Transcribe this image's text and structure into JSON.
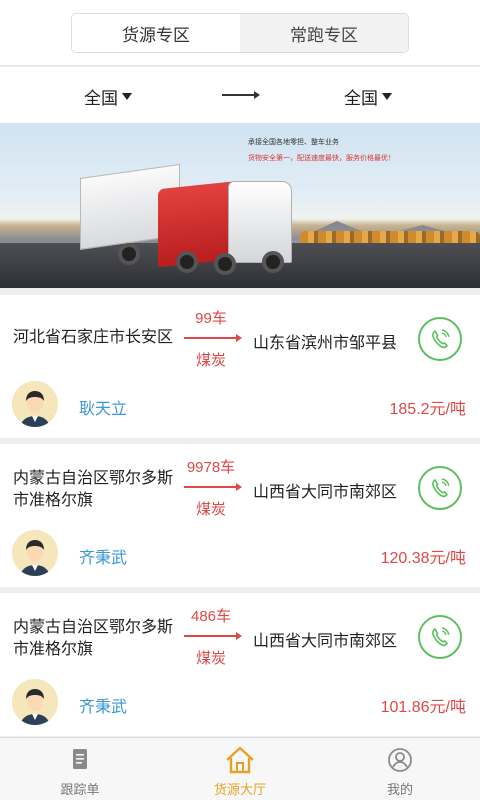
{
  "segment": {
    "tabs": [
      {
        "label": "货源专区",
        "active": true
      },
      {
        "label": "常跑专区",
        "active": false
      }
    ]
  },
  "route_filter": {
    "from": "全国",
    "to": "全国"
  },
  "banner": {
    "line1": "承接全国各地零担、整车业务",
    "line2": "货物安全第一，配送速度最快，服务价格最优！"
  },
  "listings": [
    {
      "origin": "河北省石家庄市长安区",
      "count": "99车",
      "cargo": "煤炭",
      "destination": "山东省滨州市邹平县",
      "name": "耿天立",
      "price": "185.2元/吨"
    },
    {
      "origin": "内蒙古自治区鄂尔多斯市准格尔旗",
      "count": "9978车",
      "cargo": "煤炭",
      "destination": "山西省大同市南郊区",
      "name": "齐秉武",
      "price": "120.38元/吨"
    },
    {
      "origin": "内蒙古自治区鄂尔多斯市准格尔旗",
      "count": "486车",
      "cargo": "煤炭",
      "destination": "山西省大同市南郊区",
      "name": "齐秉武",
      "price": "101.86元/吨"
    }
  ],
  "tabbar": {
    "items": [
      {
        "label": "跟踪单",
        "icon": "document-icon",
        "active": false
      },
      {
        "label": "货源大厅",
        "icon": "home-icon",
        "active": true
      },
      {
        "label": "我的",
        "icon": "user-icon",
        "active": false
      }
    ]
  },
  "colors": {
    "accent": "#e5a227",
    "price": "#e04848",
    "name": "#3a96d6",
    "phone": "#5cbf5e"
  }
}
